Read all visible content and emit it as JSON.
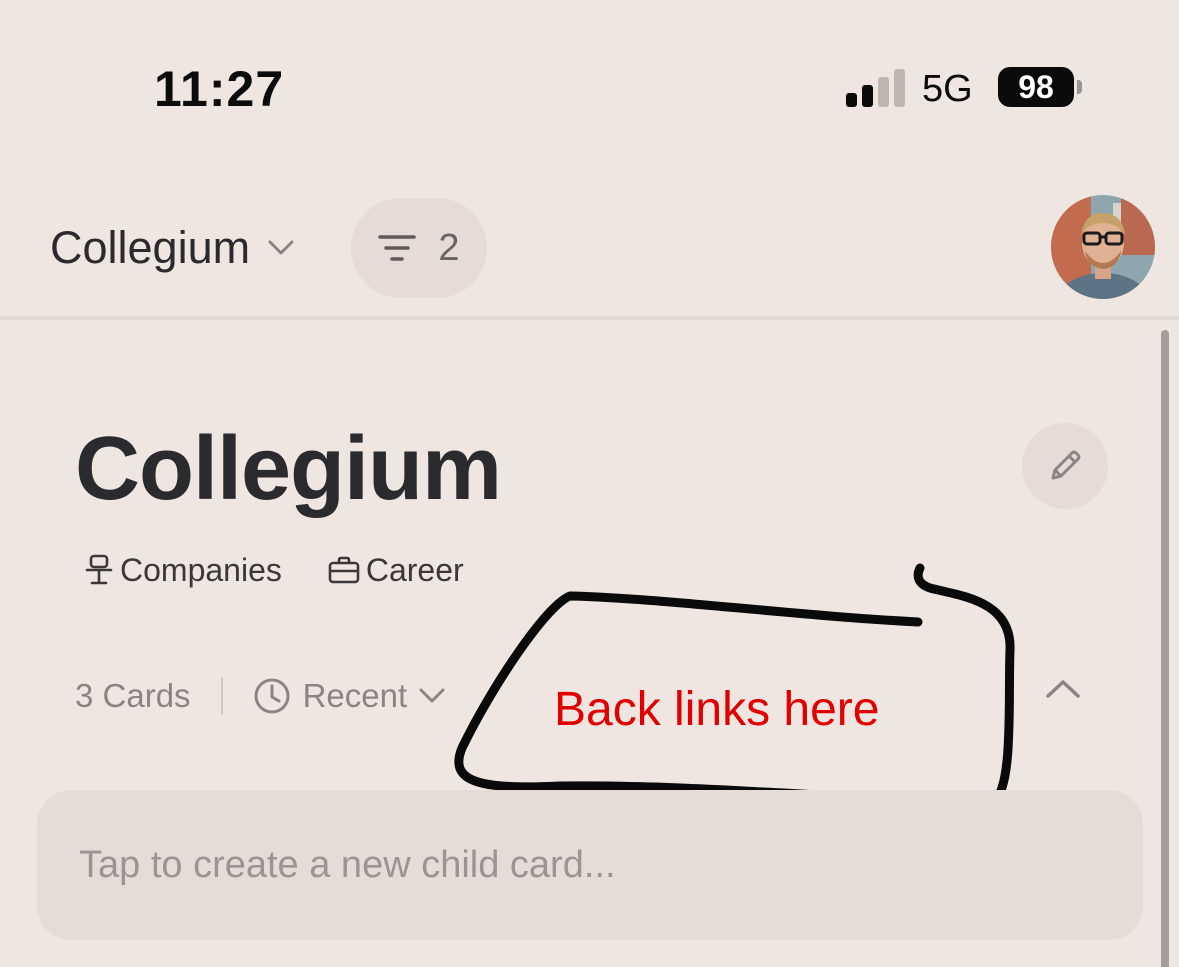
{
  "status_bar": {
    "time": "11:27",
    "network": "5G",
    "battery": "98"
  },
  "header": {
    "workspace": "Collegium",
    "filter_count": "2"
  },
  "page": {
    "title": "Collegium",
    "tags": [
      {
        "label": "Companies",
        "icon": "podium-icon"
      },
      {
        "label": "Career",
        "icon": "briefcase-icon"
      }
    ],
    "card_count": "3 Cards",
    "sort_label": "Recent"
  },
  "annotation": {
    "text": "Back links here",
    "color": "#E00000"
  },
  "new_card": {
    "placeholder": "Tap to create a new child card..."
  },
  "colors": {
    "background": "#EFE6E1",
    "pill": "#E6DBD6",
    "text": "#2B2A2E",
    "muted": "#8A8584"
  }
}
